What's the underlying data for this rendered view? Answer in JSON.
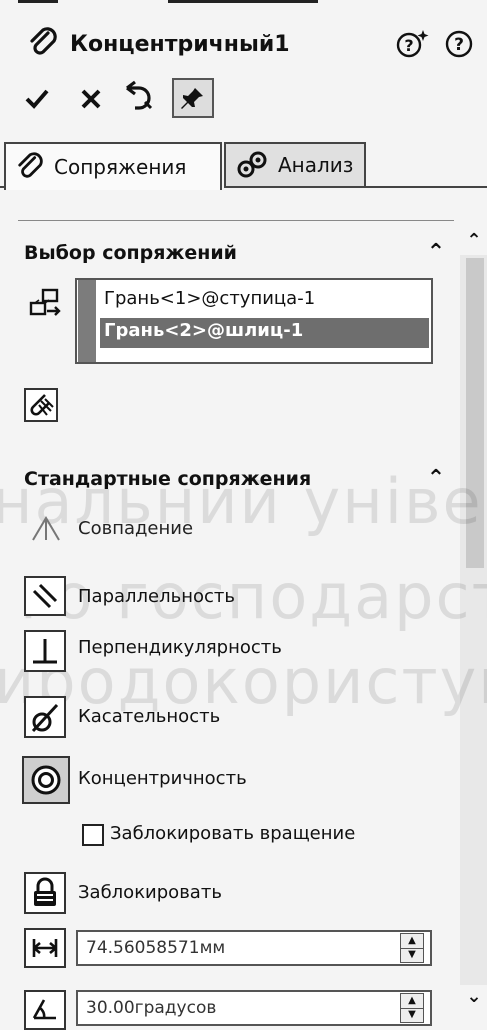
{
  "header": {
    "title": "Концентричный1",
    "help_icons": [
      "whats-new-help-icon",
      "help-icon"
    ]
  },
  "actions": {
    "ok_icon": "check-icon",
    "cancel_icon": "close-icon",
    "undo_icon": "undo-icon",
    "pin_icon": "pushpin-icon"
  },
  "tabs": [
    {
      "label": "Сопряжения",
      "icon": "paperclip-icon",
      "active": true
    },
    {
      "label": "Анализ",
      "icon": "analysis-icon",
      "active": false
    }
  ],
  "mate_selections": {
    "title": "Выбор сопряжений",
    "items": [
      "Грань<1>@ступица-1",
      "Грань<2>@шлиц-1"
    ],
    "selected_index": 1
  },
  "standard_mates": {
    "title": "Стандартные сопряжения",
    "items": [
      {
        "label": "Совпадение",
        "icon": "coincident-icon"
      },
      {
        "label": "Параллельность",
        "icon": "parallel-icon"
      },
      {
        "label": "Перпендикулярность",
        "icon": "perpendicular-icon"
      },
      {
        "label": "Касательность",
        "icon": "tangent-icon"
      },
      {
        "label": "Концентричность",
        "icon": "concentric-icon",
        "selected": true
      }
    ],
    "lock_rotation_label": "Заблокировать вращение",
    "lock_rotation_checked": false,
    "lock_label": "Заблокировать",
    "distance_value": "74.56058571мм",
    "angle_value": "30.00градусов"
  },
  "watermark": [
    "нальний універ",
    "го господарства",
    "иродокористува"
  ]
}
